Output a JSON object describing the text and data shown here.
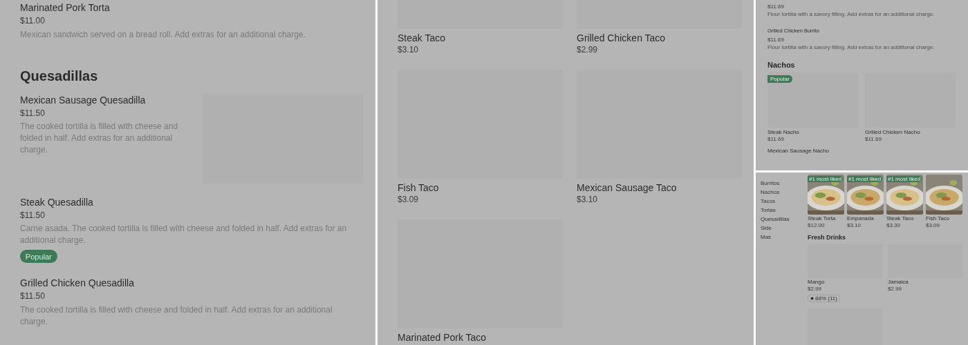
{
  "left_panel": {
    "items": [
      {
        "name": "Marinated Pork Torta",
        "price": "$11.00",
        "description": "Mexican sandwich served on a bread roll. Add extras for an additional charge."
      }
    ],
    "section_title": "Quesadillas",
    "section_items": [
      {
        "kind": "with_image",
        "name": "Mexican Sausage Quesadilla",
        "price": "$11.50",
        "description": "The cooked tortilla is filled with cheese and folded in half. Add extras for an additional charge."
      },
      {
        "kind": "text",
        "name": "Steak Quesadilla",
        "price": "$11.50",
        "description": "Carne asada. The cooked tortilla is filled with cheese and folded in half. Add extras for an additional charge.",
        "badge": "Popular"
      },
      {
        "kind": "text",
        "name": "Grilled Chicken Quesadilla",
        "price": "$11.50",
        "description": "The cooked tortilla is filled with cheese and folded in half. Add extras for an additional charge."
      }
    ]
  },
  "middle_panel": {
    "cards": [
      {
        "name": "Steak Taco",
        "price": "$3.10"
      },
      {
        "name": "Grilled Chicken Taco",
        "price": "$2.99"
      },
      {
        "name": "Fish Taco",
        "price": "$3.09"
      },
      {
        "name": "Mexican Sausage Taco",
        "price": "$3.10"
      },
      {
        "name": "Marinated Pork Taco"
      }
    ]
  },
  "right_top_panel": {
    "items": [
      {
        "price": "$11.69",
        "description": "Flour tortilla with a savory filling. Add extras for an additional charge."
      },
      {
        "name": "Grilled Chicken Burrito",
        "price": "$11.69",
        "description": "Flour tortilla with a savory filling. Add extras for an additional charge."
      }
    ],
    "section_title": "Nachos",
    "cards": [
      {
        "name": "Steak Nacho",
        "price": "$11.69",
        "badge": "Popular"
      },
      {
        "name": "Grilled Chicken Nacho",
        "price": "$11.69"
      }
    ],
    "next_item": "Mexican Sausage Nacho"
  },
  "right_bottom_panel": {
    "categories": [
      "Burritos",
      "Nachos",
      "Tacos",
      "Tortas",
      "Quesadillas",
      "Side",
      "Mas"
    ],
    "featured": [
      {
        "badge": "#1 most liked",
        "name": "Steak Torta",
        "price": "$12.00"
      },
      {
        "badge": "#1 most liked",
        "name": "Empanada",
        "price": "$3.10"
      },
      {
        "badge": "#1 most liked",
        "name": "Steak Taco",
        "price": "$3.30"
      },
      {
        "name": "Fish Taco",
        "price": "$3.09"
      }
    ],
    "section_title": "Fresh Drinks",
    "cards": [
      {
        "kind": "item",
        "name": "Mango",
        "price": "$2.99",
        "rating": "88% (11)"
      },
      {
        "kind": "item",
        "name": "Jamaica",
        "price": "$2.99"
      },
      {
        "kind": "placeholder"
      }
    ]
  }
}
